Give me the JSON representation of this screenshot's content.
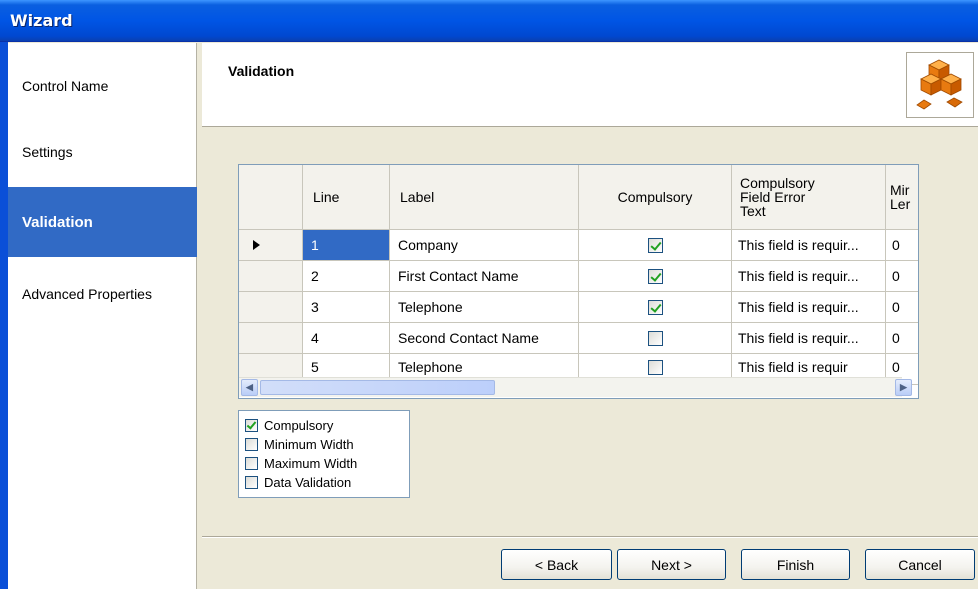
{
  "window": {
    "title": "Wizard"
  },
  "sidebar": {
    "items": [
      {
        "label": "Control Name",
        "active": false
      },
      {
        "label": "Settings",
        "active": false
      },
      {
        "label": "Validation",
        "active": true
      },
      {
        "label": "Advanced Properties",
        "active": false
      }
    ]
  },
  "header": {
    "title": "Validation",
    "logo_icon": "cubes-icon"
  },
  "grid": {
    "columns": [
      "Line",
      "Label",
      "Compulsory",
      "Compulsory\nField Error\nText",
      "Mir\nLer"
    ],
    "rows": [
      {
        "line": "1",
        "label": "Company",
        "compulsory": true,
        "error_text": "This field is requir...",
        "min_len": "0",
        "current": true
      },
      {
        "line": "2",
        "label": "First Contact Name",
        "compulsory": true,
        "error_text": "This field is requir...",
        "min_len": "0",
        "current": false
      },
      {
        "line": "3",
        "label": "Telephone",
        "compulsory": true,
        "error_text": "This field is requir...",
        "min_len": "0",
        "current": false
      },
      {
        "line": "4",
        "label": "Second Contact Name",
        "compulsory": false,
        "error_text": "This field is requir...",
        "min_len": "0",
        "current": false
      },
      {
        "line": "5",
        "label": "Telephone",
        "compulsory": false,
        "error_text": "This field is requir",
        "min_len": "0",
        "current": false
      }
    ]
  },
  "checklist": {
    "items": [
      {
        "label": "Compulsory",
        "checked": true
      },
      {
        "label": "Minimum Width",
        "checked": false
      },
      {
        "label": "Maximum Width",
        "checked": false
      },
      {
        "label": "Data Validation",
        "checked": false
      }
    ]
  },
  "buttons": {
    "back": "< Back",
    "next": "Next >",
    "finish": "Finish",
    "cancel": "Cancel"
  },
  "colors": {
    "selection": "#316ac5",
    "titlebar": "#0055e5",
    "check": "#21a121"
  }
}
